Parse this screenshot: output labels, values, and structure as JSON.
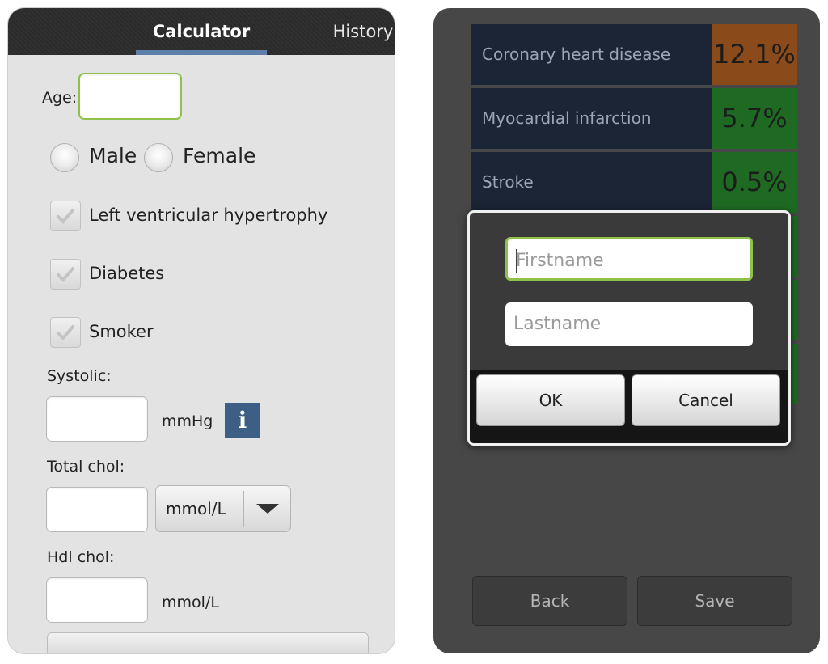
{
  "calculator": {
    "tabs": [
      {
        "label": "Calculator",
        "active": true
      },
      {
        "label": "History",
        "active": false
      }
    ],
    "age_label": "Age:",
    "age_value": "",
    "sex_options": [
      "Male",
      "Female"
    ],
    "checkboxes": [
      "Left ventricular hypertrophy",
      "Diabetes",
      "Smoker"
    ],
    "systolic_label": "Systolic:",
    "systolic_unit": "mmHg",
    "info_icon": "i",
    "total_chol_label": "Total chol:",
    "total_chol_unit_selected": "mmol/L",
    "hdl_chol_label": "Hdl chol:",
    "hdl_chol_unit": "mmol/L"
  },
  "results": {
    "rows": [
      {
        "label": "Coronary heart disease",
        "value": "12.1%",
        "color": "#8a4a1a"
      },
      {
        "label": "Myocardial infarction",
        "value": "5.7%",
        "color": "#1f6a22"
      },
      {
        "label": "Stroke",
        "value": "0.5%",
        "color": "#1f6a22"
      },
      {
        "label": "",
        "value": "",
        "color": "#1f6a22"
      },
      {
        "label": "",
        "value": "",
        "color": "#1f6a22"
      },
      {
        "label": "",
        "value": "",
        "color": "#1f6a22"
      }
    ],
    "dialog": {
      "firstname_placeholder": "Firstname",
      "lastname_placeholder": "Lastname",
      "ok_label": "OK",
      "cancel_label": "Cancel"
    },
    "back_label": "Back",
    "save_label": "Save"
  },
  "colors": {
    "accent_blue": "#5d7ea8",
    "focus_green": "#8ec24a",
    "risk_high": "#8a4a1a",
    "risk_low": "#1f6a22"
  }
}
